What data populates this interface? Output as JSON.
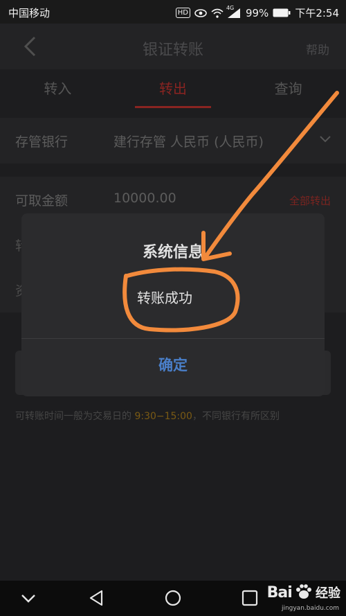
{
  "status_bar": {
    "carrier": "中国移动",
    "hd": "HD",
    "network": "4G",
    "battery": "99%",
    "time": "下午2:54"
  },
  "nav": {
    "title": "银证转账",
    "help": "帮助"
  },
  "tabs": [
    {
      "label": "转入",
      "active": false
    },
    {
      "label": "转出",
      "active": true
    },
    {
      "label": "查询",
      "active": false
    }
  ],
  "form": {
    "bank_label": "存管银行",
    "bank_value": "建行存管 人民币 (人民币)",
    "available_label": "可取金额",
    "available_value": "10000.00",
    "all_out": "全部转出",
    "amount_label_partial": "转",
    "password_label_partial": "资"
  },
  "note": {
    "prefix": "可转账时间一般为交易日的 ",
    "time": "9:30−15:00",
    "suffix": "，不同银行有所区别"
  },
  "dialog": {
    "title": "系统信息",
    "message": "转账成功",
    "ok": "确定"
  },
  "watermark": {
    "brand": "Bai",
    "brand_cn": "经验",
    "url": "jingyan.baidu.com"
  },
  "colors": {
    "accent_red": "#8a2421",
    "dialog_button": "#4a7fc9",
    "annotation": "#f28a3c"
  }
}
